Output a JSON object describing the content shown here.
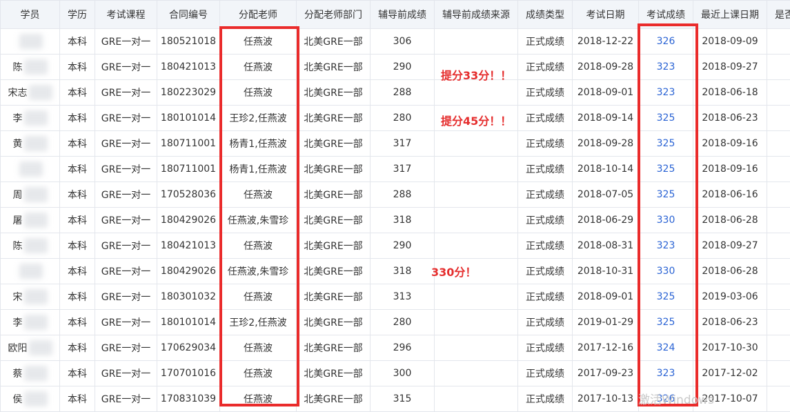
{
  "table": {
    "headers": [
      "学员",
      "学历",
      "考试课程",
      "合同编号",
      "分配老师",
      "分配老师部门",
      "辅导前成绩",
      "辅导前成绩来源",
      "成绩类型",
      "考试日期",
      "考试成绩",
      "最近上课日期",
      "是否"
    ],
    "rows": [
      {
        "student": "",
        "edu": "本科",
        "course": "GRE一对一",
        "contract": "180521018",
        "teacher": "任燕波",
        "dept": "北美GRE一部",
        "pre": "306",
        "source": "",
        "type": "正式成绩",
        "date": "2018-12-22",
        "score": "326",
        "last": "2018-09-09"
      },
      {
        "student": "陈",
        "edu": "本科",
        "course": "GRE一对一",
        "contract": "180421013",
        "teacher": "任燕波",
        "dept": "北美GRE一部",
        "pre": "290",
        "source": "",
        "type": "正式成绩",
        "date": "2018-09-28",
        "score": "323",
        "last": "2018-09-27"
      },
      {
        "student": "宋志",
        "edu": "本科",
        "course": "GRE一对一",
        "contract": "180223029",
        "teacher": "任燕波",
        "dept": "北美GRE一部",
        "pre": "288",
        "source": "",
        "type": "正式成绩",
        "date": "2018-09-01",
        "score": "323",
        "last": "2018-06-18"
      },
      {
        "student": "李",
        "edu": "本科",
        "course": "GRE一对一",
        "contract": "180101014",
        "teacher": "王珍2,任燕波",
        "dept": "北美GRE一部",
        "pre": "280",
        "source": "",
        "type": "正式成绩",
        "date": "2018-09-14",
        "score": "325",
        "last": "2018-06-23"
      },
      {
        "student": "黄",
        "edu": "本科",
        "course": "GRE一对一",
        "contract": "180711001",
        "teacher": "杨青1,任燕波",
        "dept": "北美GRE一部",
        "pre": "317",
        "source": "",
        "type": "正式成绩",
        "date": "2018-09-28",
        "score": "325",
        "last": "2018-09-16"
      },
      {
        "student": "",
        "edu": "本科",
        "course": "GRE一对一",
        "contract": "180711001",
        "teacher": "杨青1,任燕波",
        "dept": "北美GRE一部",
        "pre": "317",
        "source": "",
        "type": "正式成绩",
        "date": "2018-10-14",
        "score": "325",
        "last": "2018-09-16"
      },
      {
        "student": "周",
        "edu": "本科",
        "course": "GRE一对一",
        "contract": "170528036",
        "teacher": "任燕波",
        "dept": "北美GRE一部",
        "pre": "288",
        "source": "",
        "type": "正式成绩",
        "date": "2018-07-05",
        "score": "325",
        "last": "2018-06-16"
      },
      {
        "student": "屠",
        "edu": "本科",
        "course": "GRE一对一",
        "contract": "180429026",
        "teacher": "任燕波,朱雪珍",
        "dept": "北美GRE一部",
        "pre": "318",
        "source": "",
        "type": "正式成绩",
        "date": "2018-06-29",
        "score": "330",
        "last": "2018-06-28"
      },
      {
        "student": "陈",
        "edu": "本科",
        "course": "GRE一对一",
        "contract": "180421013",
        "teacher": "任燕波",
        "dept": "北美GRE一部",
        "pre": "290",
        "source": "",
        "type": "正式成绩",
        "date": "2018-08-31",
        "score": "323",
        "last": "2018-09-27"
      },
      {
        "student": "",
        "edu": "本科",
        "course": "GRE一对一",
        "contract": "180429026",
        "teacher": "任燕波,朱雪珍",
        "dept": "北美GRE一部",
        "pre": "318",
        "source": "",
        "type": "正式成绩",
        "date": "2018-10-31",
        "score": "330",
        "last": "2018-06-28"
      },
      {
        "student": "宋",
        "edu": "本科",
        "course": "GRE一对一",
        "contract": "180301032",
        "teacher": "任燕波",
        "dept": "北美GRE一部",
        "pre": "313",
        "source": "",
        "type": "正式成绩",
        "date": "2018-09-01",
        "score": "325",
        "last": "2019-03-06"
      },
      {
        "student": "李",
        "edu": "本科",
        "course": "GRE一对一",
        "contract": "180101014",
        "teacher": "王珍2,任燕波",
        "dept": "北美GRE一部",
        "pre": "280",
        "source": "",
        "type": "正式成绩",
        "date": "2019-01-29",
        "score": "325",
        "last": "2018-06-23"
      },
      {
        "student": "欧阳",
        "edu": "本科",
        "course": "GRE一对一",
        "contract": "170629034",
        "teacher": "任燕波",
        "dept": "北美GRE一部",
        "pre": "296",
        "source": "",
        "type": "正式成绩",
        "date": "2017-12-16",
        "score": "324",
        "last": "2017-10-30"
      },
      {
        "student": "蔡",
        "edu": "本科",
        "course": "GRE一对一",
        "contract": "170701016",
        "teacher": "任燕波",
        "dept": "北美GRE一部",
        "pre": "300",
        "source": "",
        "type": "正式成绩",
        "date": "2017-09-23",
        "score": "323",
        "last": "2017-12-02"
      },
      {
        "student": "侯",
        "edu": "本科",
        "course": "GRE一对一",
        "contract": "170831039",
        "teacher": "任燕波",
        "dept": "北美GRE一部",
        "pre": "315",
        "source": "",
        "type": "正式成绩",
        "date": "2017-10-13",
        "score": "326",
        "last": "2017-10-07"
      }
    ]
  },
  "annotations": {
    "note1": "提分33分！！",
    "note2": "提分45分！！",
    "note3": "330分！",
    "highlight_color": "#ea2b2b"
  },
  "watermark": "激活Windows",
  "colors": {
    "header_bg": "#f2f5f9",
    "score_link": "#2a63d4",
    "border": "#e3e6ec"
  }
}
